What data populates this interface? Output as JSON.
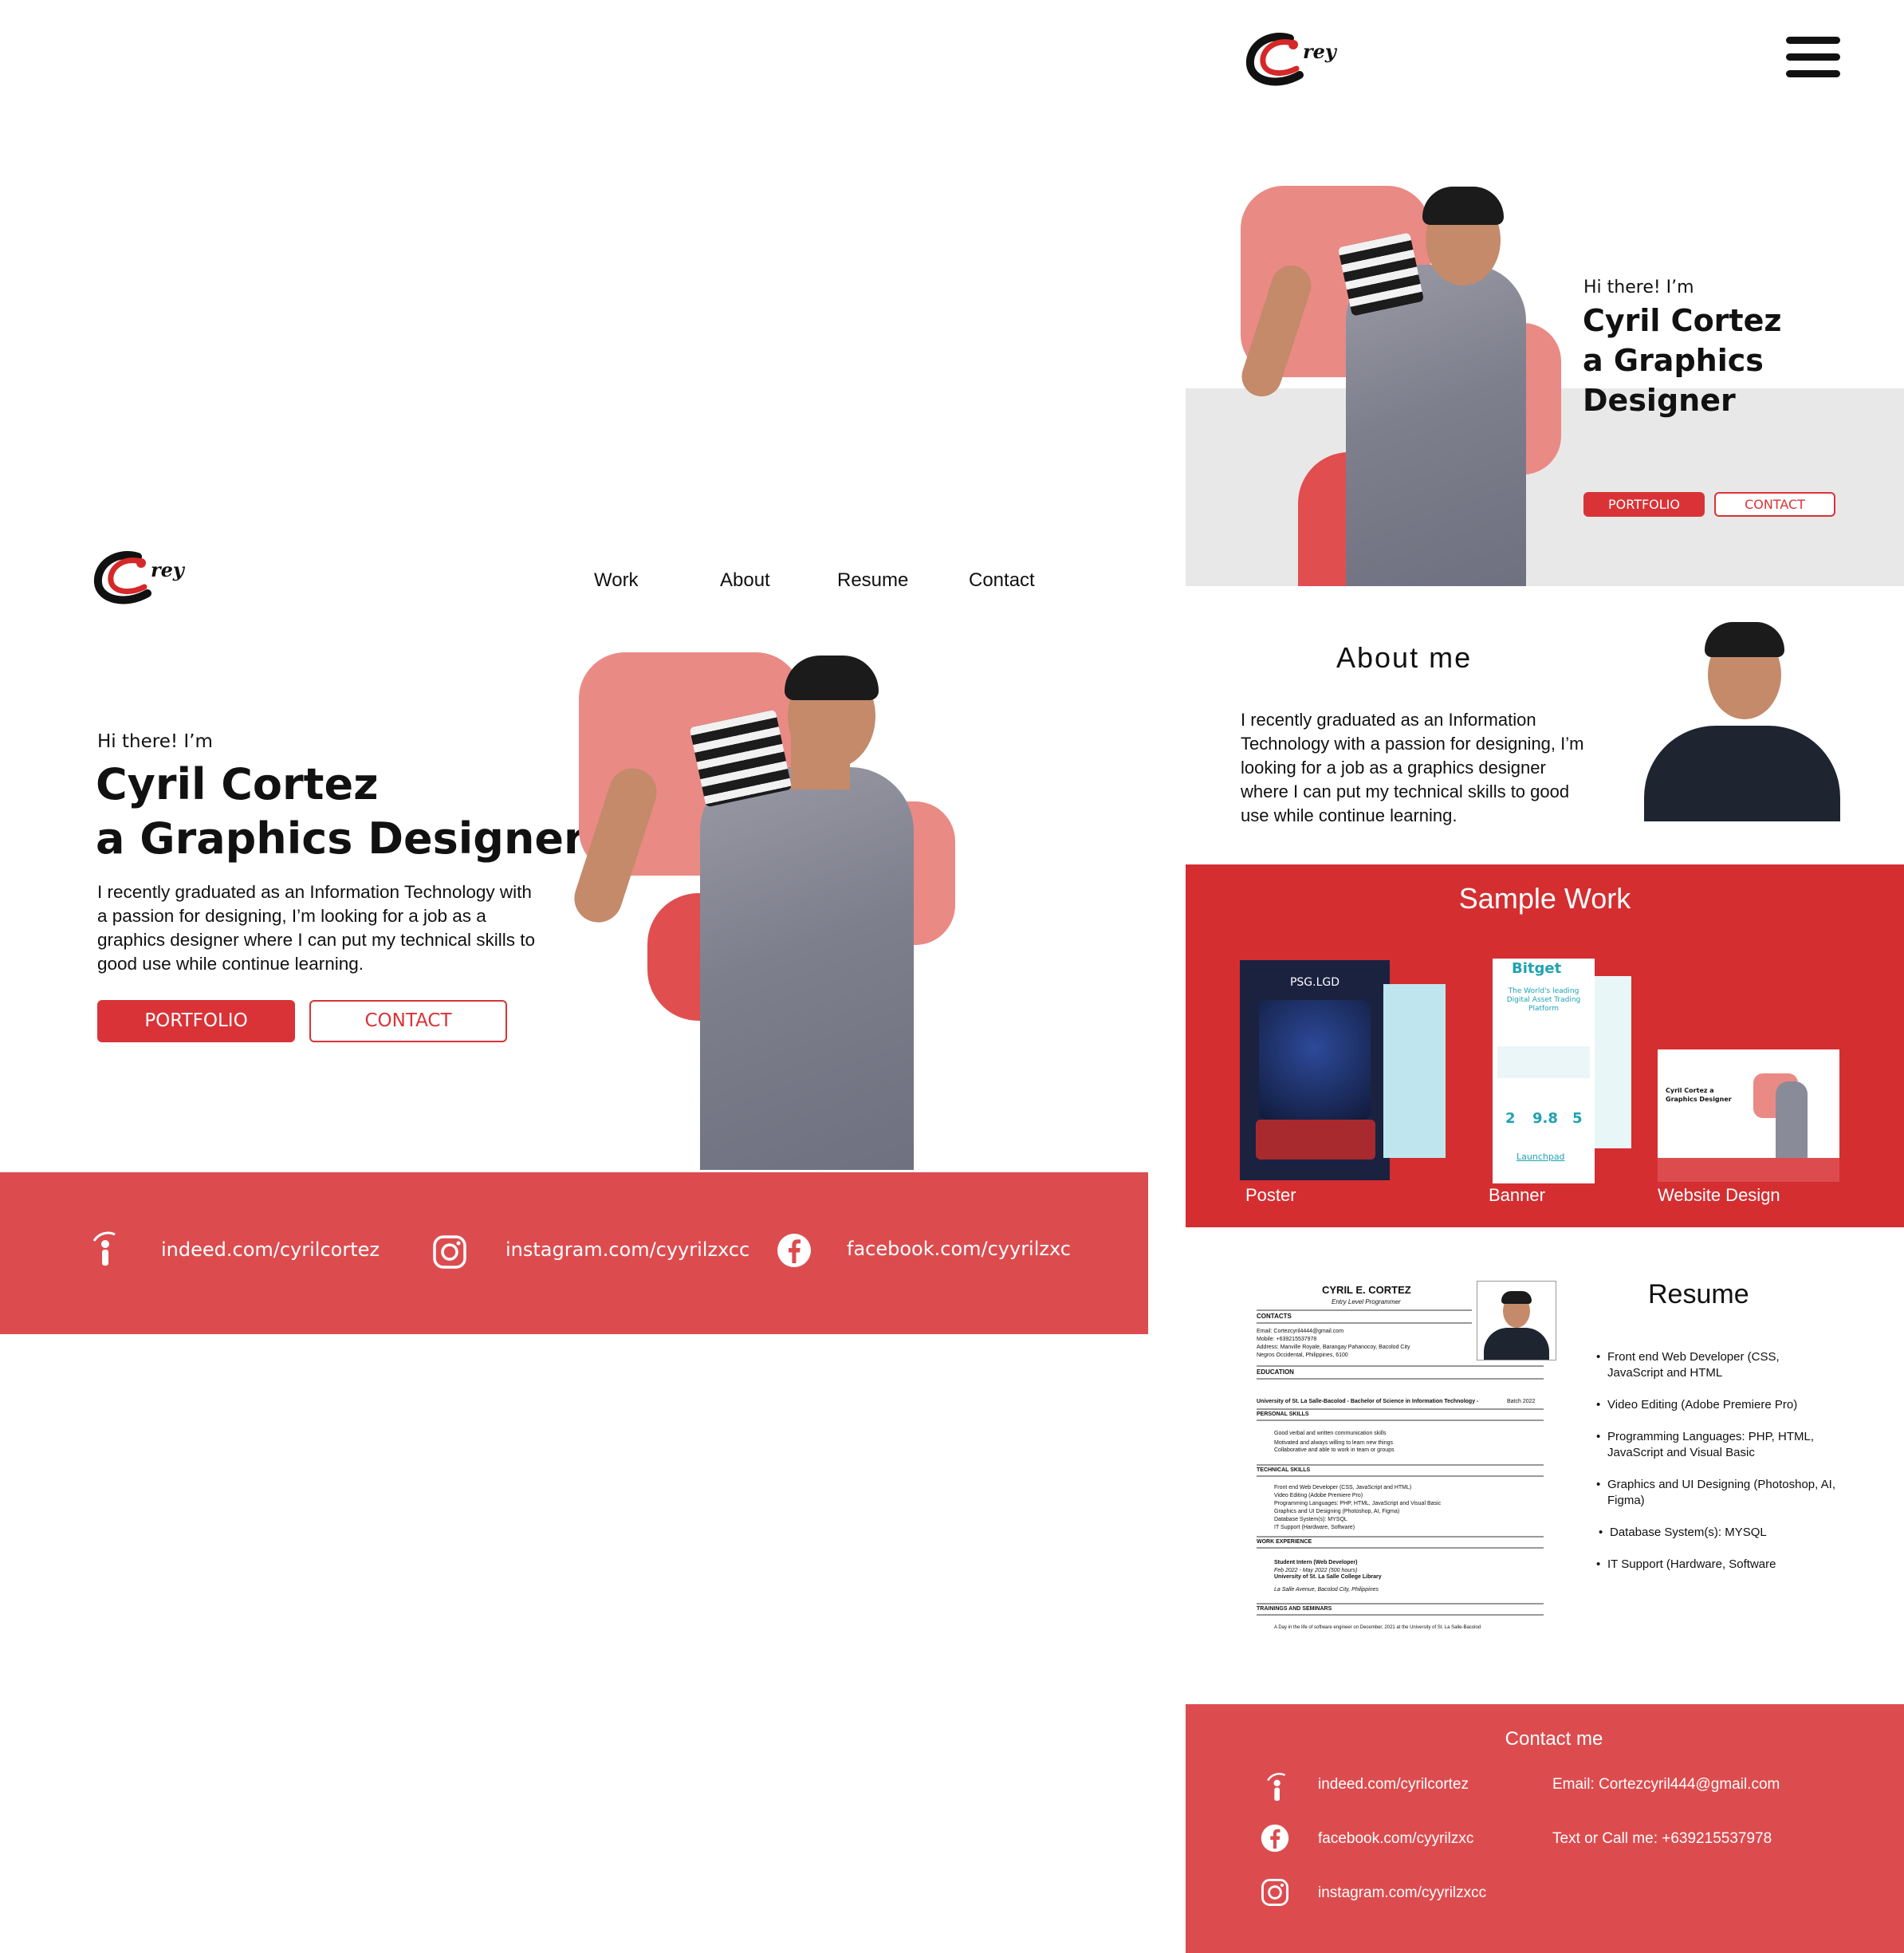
{
  "desktop": {
    "logo_text": "rey",
    "nav": [
      "Work",
      "About",
      "Resume",
      "Contact"
    ],
    "hero": {
      "greeting": "Hi there! I’m",
      "name_line1": "Cyril Cortez",
      "name_line2": "a Graphics Designer",
      "description": "I recently graduated as an Information Technology with a passion for designing, I’m looking for a job as a graphics designer where I can put my technical skills to good use while continue learning.",
      "portfolio_label": "PORTFOLIO",
      "contact_label": "CONTACT"
    },
    "footer": {
      "indeed": "indeed.com/cyrilcortez",
      "instagram": "instagram.com/cyyrilzxcc",
      "facebook": "facebook.com/cyyrilzxc"
    }
  },
  "mobile": {
    "logo_text": "rey",
    "hero": {
      "greeting": "Hi there! I’m",
      "name_line1": "Cyril Cortez",
      "name_line2": "a Graphics",
      "name_line3": "Designer",
      "portfolio_label": "PORTFOLIO",
      "contact_label": "CONTACT"
    },
    "about": {
      "title": "About me",
      "text": "I recently graduated as an Information Technology with a passion for designing, I’m looking for a job as a graphics designer where I can put my technical skills to good use while continue learning."
    },
    "sample_work": {
      "title": "Sample Work",
      "items": [
        {
          "label": "Poster",
          "poster_title": "PSG.LGD"
        },
        {
          "label": "Banner",
          "banner_brand": "Bitget",
          "banner_tagline": "The World's leading Digital Asset Trading Platform",
          "banner_stat1": "2",
          "banner_stat2": "9.8",
          "banner_stat3": "5",
          "banner_launch": "Launchpad"
        },
        {
          "label": "Website Design",
          "site_title": "Cyril Cortez a Graphics Designer"
        }
      ]
    },
    "resume": {
      "title": "Resume",
      "doc": {
        "name": "CYRIL E. CORTEZ",
        "role": "Entry Level Programmer",
        "sections": [
          "CONTACTS",
          "EDUCATION",
          "PERSONAL SKILLS",
          "TECHNICAL SKILLS",
          "WORK EXPERIENCE",
          "TRAININGS AND SEMINARS"
        ],
        "email": "Email: Cortezcyril4444@gmail.com",
        "mobile": "Mobile: +639215537978",
        "address": "Address: Manville Royale, Barangay Pahanocoy, Bacolod City",
        "address2": "Negros Occidental, Philippines, 6100",
        "school": "University of St. La Salle-Bacolod - Bachelor of Science in Information Technology -",
        "batch": "Batch 2022",
        "personal": [
          "Good verbal and written communication skills",
          "Motivated and always willing to learn new things",
          "Collaborative and able to work in team or groups"
        ],
        "technical": [
          "Front end Web Developer (CSS, JavaScript and HTML)",
          "Video Editing (Adobe Premiere Pro)",
          "Programming Languages: PHP, HTML, JavaScript and Visual Basic",
          "Graphics and UI Designing (Photoshop, AI, Figma)",
          "Database System(s): MYSQL",
          "IT Support (Hardware, Software)"
        ],
        "work_title": "Student Intern (Web Developer)",
        "work_dates": "Feb 2022 - May 2022 (500 hours)",
        "work_place": "University of St. La Salle College Library",
        "work_addr": "La Salle Avenue, Bacolod City, Philippines",
        "training": "A Day in the life of software engineer on December, 2021 at the University of St. La Salle-Bacolod"
      },
      "skills": [
        "Front end Web Developer (CSS, JavaScript and HTML",
        "Video Editing (Adobe Premiere Pro)",
        "Programming Languages: PHP, HTML, JavaScript and Visual Basic",
        "Graphics and UI Designing (Photoshop, AI, Figma)",
        "Database System(s): MYSQL",
        "IT Support (Hardware, Software"
      ]
    },
    "contact": {
      "title": "Contact me",
      "indeed": "indeed.com/cyrilcortez",
      "facebook": "facebook.com/cyyrilzxc",
      "instagram": "instagram.com/cyyrilzxcc",
      "email": "Email: Cortezcyril444@gmail.com",
      "phone": "Text or Call me: +639215537978"
    }
  },
  "colors": {
    "accent": "#d93337",
    "accent_soft": "#e14e4f",
    "pink": "#ea8a85",
    "gray_band": "#e8e8e8"
  }
}
